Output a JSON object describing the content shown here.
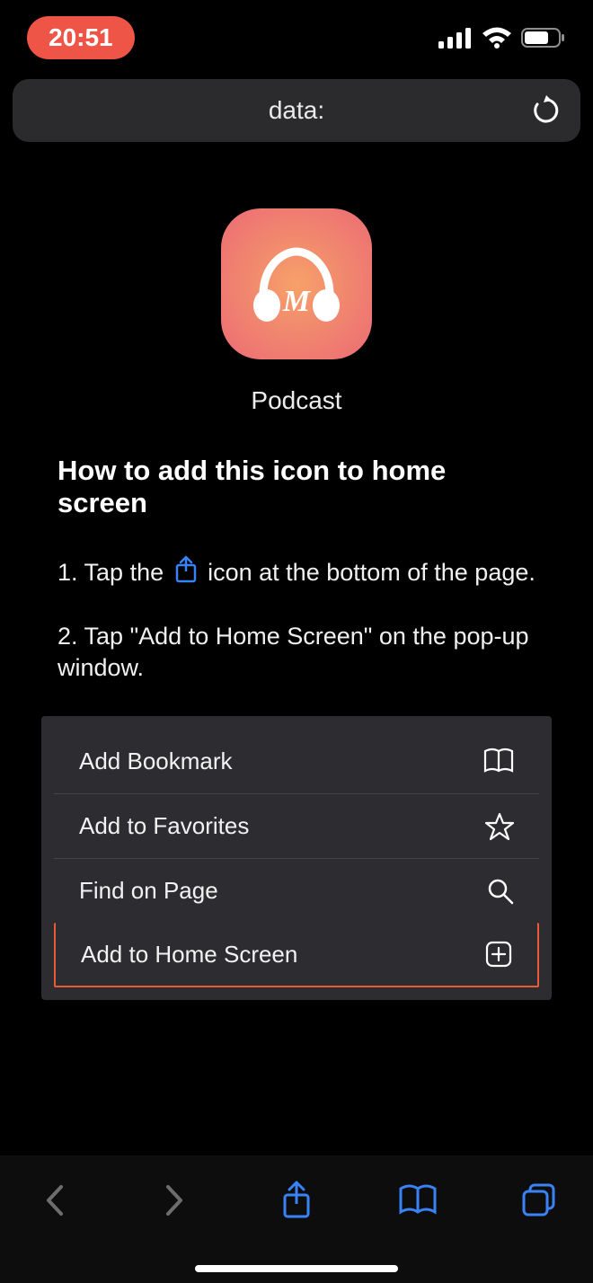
{
  "status": {
    "time": "20:51"
  },
  "url_bar": {
    "text": "data:"
  },
  "app": {
    "label": "Podcast",
    "letter": "M"
  },
  "heading": "How to add this icon to home screen",
  "steps": {
    "s1_pre": "1. Tap the ",
    "s1_post": " icon at the bottom of the page.",
    "s2": "2. Tap \"Add to Home Screen\" on the pop-up window."
  },
  "menu": {
    "items": [
      {
        "label": "Add Bookmark",
        "icon": "book"
      },
      {
        "label": "Add to Favorites",
        "icon": "star"
      },
      {
        "label": "Find on Page",
        "icon": "search"
      },
      {
        "label": "Add to Home Screen",
        "icon": "plus",
        "highlighted": true
      }
    ]
  },
  "colors": {
    "blue": "#3a82f7",
    "time_pill": "#ee5547",
    "highlight_border": "#e85a3a"
  }
}
